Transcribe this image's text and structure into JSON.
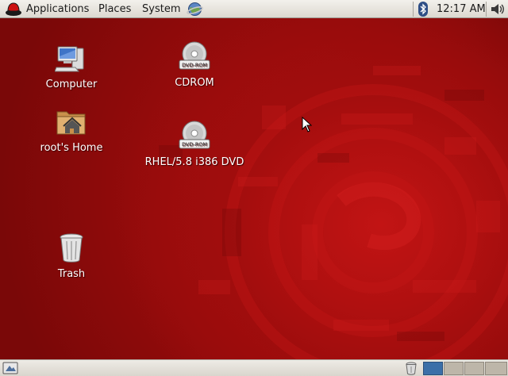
{
  "top_panel": {
    "menus": [
      {
        "label": "Applications",
        "icon": "redhat-icon"
      },
      {
        "label": "Places"
      },
      {
        "label": "System"
      }
    ],
    "launchers": [
      {
        "icon": "web-browser-icon"
      }
    ],
    "tray": {
      "bluetooth_icon": "bluetooth-icon",
      "clock": "12:17 AM",
      "volume_icon": "speaker-icon"
    }
  },
  "desktop": {
    "icons": [
      {
        "label": "Computer",
        "icon": "computer-icon"
      },
      {
        "label": "root's Home",
        "icon": "home-folder-icon"
      },
      {
        "label": "Trash",
        "icon": "trash-icon"
      },
      {
        "label": "CDROM",
        "icon": "dvd-rom-icon",
        "badge": "DVD-ROM"
      },
      {
        "label": "RHEL/5.8 i386 DVD",
        "icon": "dvd-rom-icon",
        "badge": "DVD-ROM"
      }
    ]
  },
  "bottom_panel": {
    "show_desktop_icon": "show-desktop-icon",
    "trash_icon": "trash-icon",
    "workspaces": [
      {
        "index": 1,
        "active": true
      },
      {
        "index": 2,
        "active": false
      },
      {
        "index": 3,
        "active": false
      },
      {
        "index": 4,
        "active": false
      }
    ]
  },
  "colors": {
    "desktop_red": "#a30e0e",
    "panel": "#e6e3dd",
    "active_workspace": "#3b6fa8"
  }
}
